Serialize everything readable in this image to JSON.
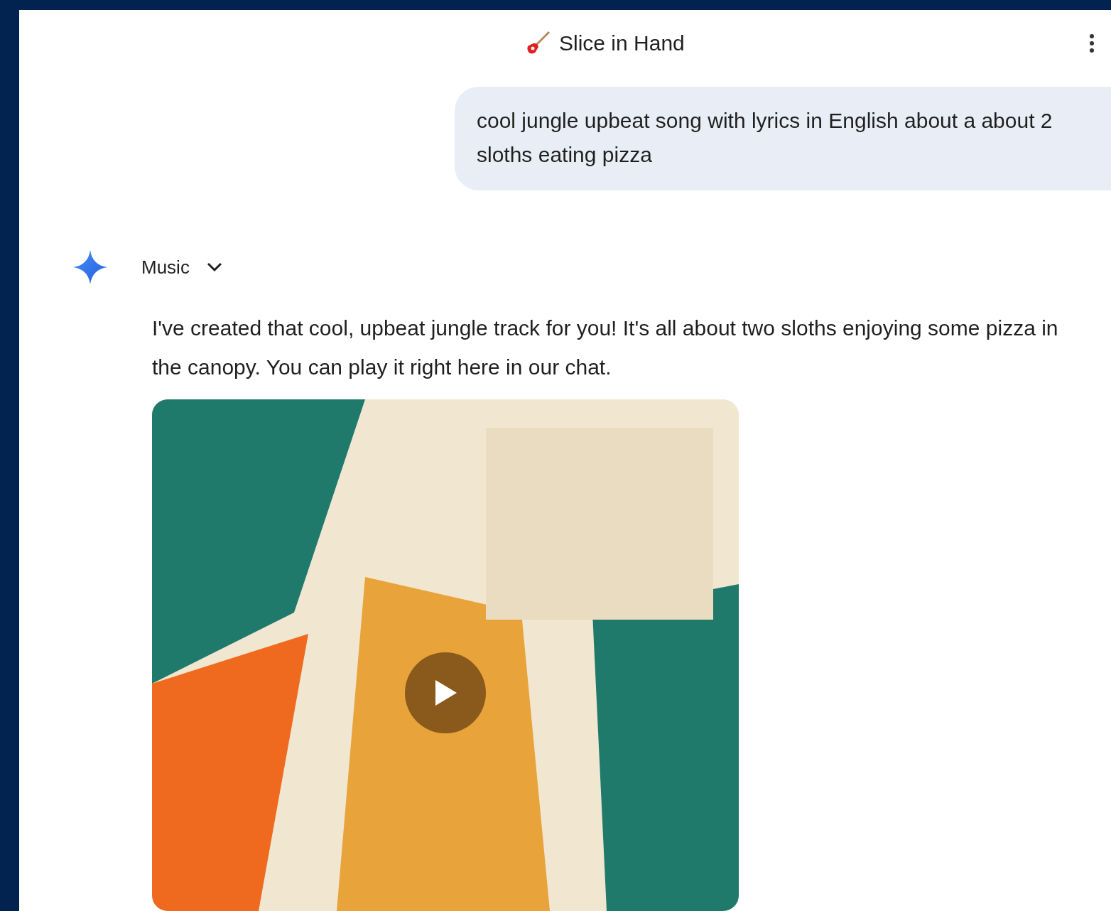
{
  "header": {
    "title": "Slice in Hand"
  },
  "user_message": {
    "text": "cool jungle upbeat song with lyrics in English about a about 2 sloths eating pizza"
  },
  "response": {
    "tool_label": "Music",
    "text": "I've created that cool, upbeat jungle track for you! It's all about two sloths enjoying some pizza in the canopy. You can play it right here in our chat."
  }
}
